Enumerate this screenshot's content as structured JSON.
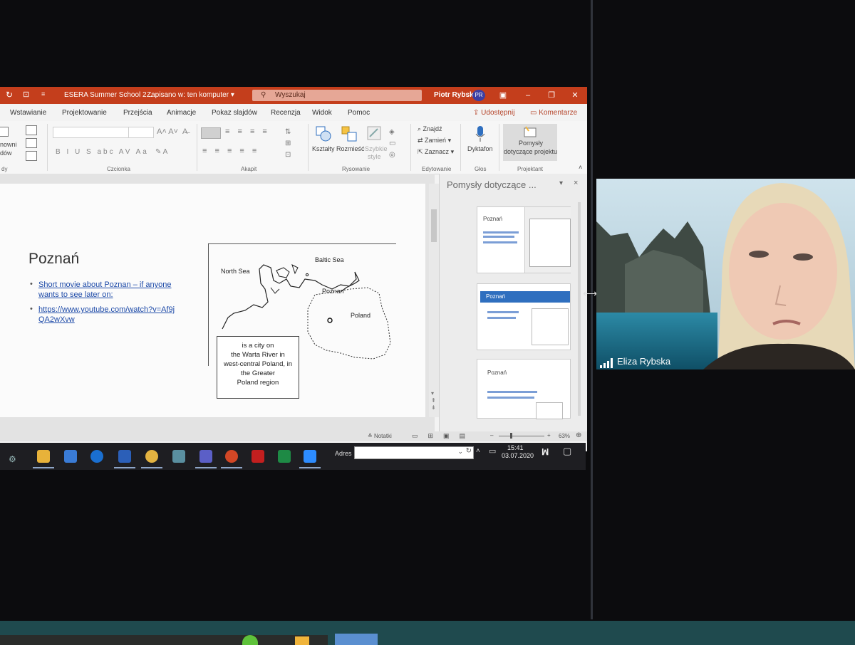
{
  "titlebar": {
    "doc_title": "ESERA Summer School 2...",
    "save_status": "Zapisano w: ten komputer ▾",
    "search_placeholder": "Wyszukaj",
    "user_name": "Piotr Rybski",
    "user_initials": "PR"
  },
  "tabs": [
    "Wstawianie",
    "Projektowanie",
    "Przejścia",
    "Animacje",
    "Pokaz slajdów",
    "Recenzja",
    "Widok",
    "Pomoc"
  ],
  "share_label": "Udostępnij",
  "comments_label": "Komentarze",
  "ribbon": {
    "left_items": [
      "nowni",
      "dów"
    ],
    "groups": {
      "slides": "dy",
      "font": "Czcionka",
      "paragraph": "Akapit",
      "drawing": "Rysowanie",
      "editing": "Edytowanie",
      "voice": "Głos",
      "designer": "Projektant"
    },
    "shapes": "Kształty",
    "arrange": "Rozmieść",
    "quick_styles_1": "Szybkie",
    "quick_styles_2": "style",
    "find": "Znajdź",
    "replace": "Zamień",
    "select": "Zaznacz",
    "dictate": "Dyktafon",
    "design_ideas_1": "Pomysły",
    "design_ideas_2": "dotyczące projektu"
  },
  "slide": {
    "title": "Poznań",
    "bullet1_line1": "Short movie about Poznan – if anyone",
    "bullet1_line2": "wants to see later on:",
    "bullet2_line1": "https://www.youtube.com/watch?v=Af9j",
    "bullet2_line2": "QA2wXvw",
    "map": {
      "north_sea": "North Sea",
      "baltic_sea": "Baltic Sea",
      "poznan": "Poznan",
      "poland": "Poland"
    },
    "caption": [
      "is a city on",
      "the Warta River in",
      "west-central Poland, in",
      "the Greater",
      "Poland region"
    ]
  },
  "designer_pane": {
    "title": "Pomysły dotyczące ...",
    "close": "×",
    "card1_title": "Poznań",
    "card2_title": "Poznań",
    "card3_title": "Poznań"
  },
  "statusbar": {
    "notes": "Notatki",
    "zoom": "63%"
  },
  "taskbar": {
    "address_label": "Adres",
    "time": "15:41",
    "date": "03.07.2020"
  },
  "video": {
    "participant_name": "Eliza Rybska"
  },
  "colors": {
    "ppt_accent": "#c43e1c",
    "link": "#1d4aa8",
    "designer_blue": "#2f6fbf"
  }
}
